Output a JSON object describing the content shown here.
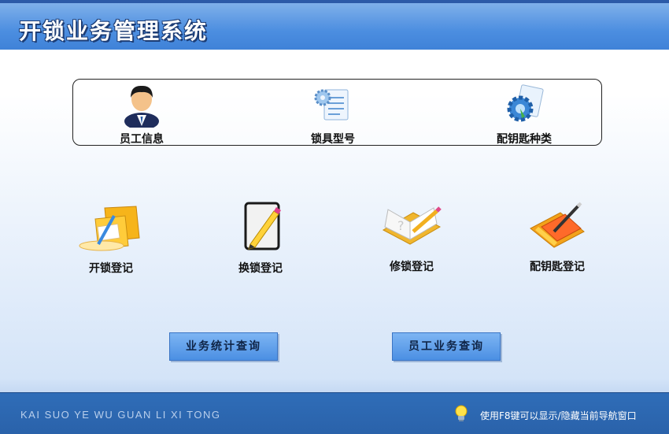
{
  "header": {
    "title": "开锁业务管理系统"
  },
  "config_panel": {
    "items": [
      {
        "label": "员工信息",
        "icon": "user-icon"
      },
      {
        "label": "锁具型号",
        "icon": "settings-document-icon"
      },
      {
        "label": "配钥匙种类",
        "icon": "gear-document-icon"
      }
    ]
  },
  "modules": [
    {
      "label": "开锁登记",
      "icon": "folder-pen-icon"
    },
    {
      "label": "换锁登记",
      "icon": "edit-document-icon"
    },
    {
      "label": "修锁登记",
      "icon": "book-pencil-icon"
    },
    {
      "label": "配钥匙登记",
      "icon": "orange-folder-pen-icon"
    }
  ],
  "buttons": {
    "stats": "业务统计查询",
    "staff": "员工业务查询"
  },
  "footer": {
    "pinyin": "KAI SUO YE WU GUAN LI XI TONG",
    "hint": "使用F8键可以显示/隐藏当前导航窗口",
    "hint_icon": "lightbulb-icon"
  },
  "colors": {
    "header": "#4c8ee0",
    "footer": "#2f6db8",
    "button": "#5c9fe9"
  }
}
